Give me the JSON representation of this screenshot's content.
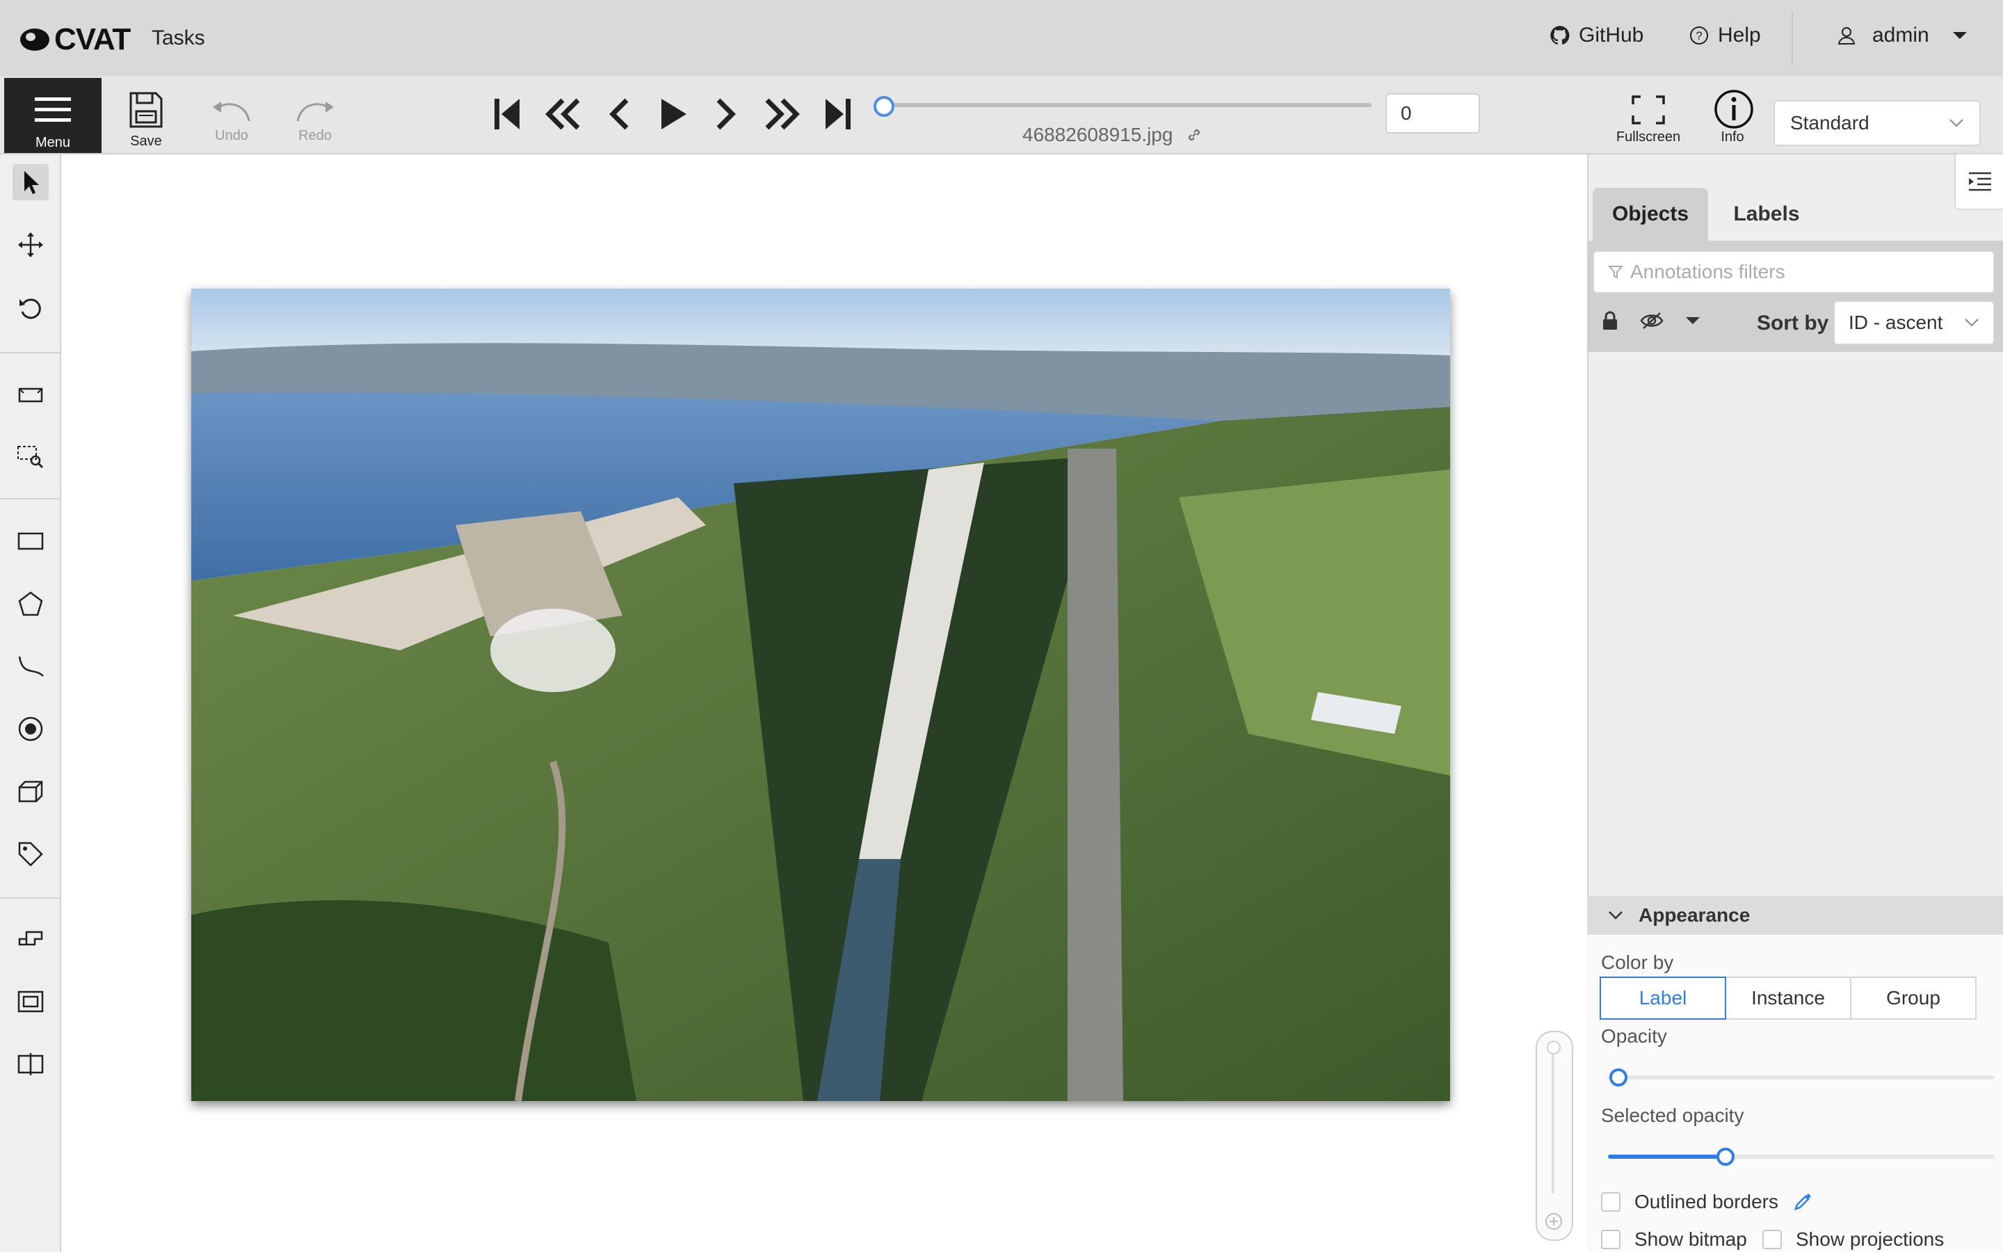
{
  "header": {
    "logo_text": "CVAT",
    "tasks_label": "Tasks",
    "github_label": "GitHub",
    "help_label": "Help",
    "user_label": "admin"
  },
  "toolbar": {
    "menu_label": "Menu",
    "save_label": "Save",
    "undo_label": "Undo",
    "redo_label": "Redo",
    "filename": "46882608915.jpg",
    "frame_value": "0",
    "fullscreen_label": "Fullscreen",
    "info_label": "Info",
    "workspace_value": "Standard",
    "frame_progress": 0
  },
  "left_tools": [
    "cursor-icon",
    "move-icon",
    "rotate-icon",
    "fit-icon",
    "zoom-region-icon",
    "rectangle-icon",
    "polygon-icon",
    "polyline-icon",
    "points-icon",
    "cuboid-icon",
    "tag-icon",
    "merge-icon",
    "group-icon",
    "split-icon"
  ],
  "sidebar": {
    "tabs": {
      "objects": "Objects",
      "labels": "Labels"
    },
    "filters_placeholder": "Annotations filters",
    "sort_label": "Sort by",
    "sort_value": "ID - ascent",
    "appearance": {
      "title": "Appearance",
      "color_by_label": "Color by",
      "color_by_options": [
        "Label",
        "Instance",
        "Group"
      ],
      "color_by_selected": "Label",
      "opacity_label": "Opacity",
      "opacity_value": 0.01,
      "selected_opacity_label": "Selected opacity",
      "selected_opacity_value": 0.3,
      "outlined_borders_label": "Outlined borders",
      "show_bitmap_label": "Show bitmap",
      "show_projections_label": "Show projections"
    }
  },
  "colors": {
    "accent": "#2f7ee8",
    "header_bg": "#d9d9d9",
    "toolbar_bg": "#e6e6e6",
    "menu_bg": "#242424"
  }
}
